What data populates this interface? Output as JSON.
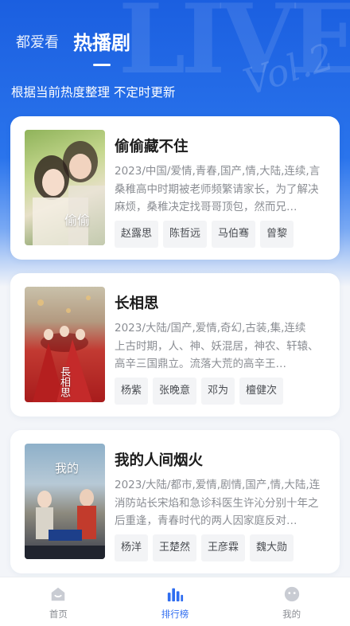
{
  "header": {
    "tab_inactive": "都爱看",
    "tab_active": "热播剧",
    "subtitle": "根据当前热度整理 不定时更新",
    "deco_text": "LIVE",
    "deco_text2": "Vol.2"
  },
  "dramas": [
    {
      "title": "偷偷藏不住",
      "meta": "2023/中国/爱情,青春,国产,情,大陆,连续,言",
      "desc": "桑稚高中时期被老师频繁请家长，为了解决麻烦，桑稚决定找哥哥顶包，然而兄…",
      "cast": [
        "赵露思",
        "陈哲远",
        "马伯骞",
        "曾黎"
      ],
      "poster_text": "偷偷"
    },
    {
      "title": "长相思",
      "meta": "2023/大陆/国产,爱情,奇幻,古装,集,连续",
      "desc": "上古时期，人、神、妖混居，神农、轩辕、高辛三国鼎立。流落大荒的高辛王…",
      "cast": [
        "杨紫",
        "张晚意",
        "邓为",
        "檀健次"
      ],
      "poster_text": "長相思"
    },
    {
      "title": "我的人间烟火",
      "meta": "2023/大陆/都市,爱情,剧情,国产,情,大陆,连",
      "desc": "消防站长宋焰和急诊科医生许沁分别十年之后重逢，青春时代的两人因家庭反对…",
      "cast": [
        "杨洋",
        "王楚然",
        "王彦霖",
        "魏大勋"
      ],
      "poster_text": "我的"
    }
  ],
  "nav": {
    "home": "首页",
    "rank": "排行榜",
    "me": "我的"
  },
  "colors": {
    "accent": "#2f6df0",
    "hero": "#1b5fe0"
  }
}
